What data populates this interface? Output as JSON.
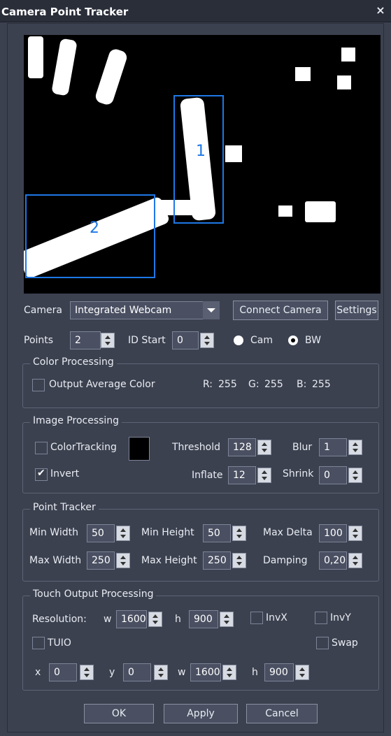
{
  "window": {
    "title": "Camera Point Tracker",
    "close_glyph": "×"
  },
  "preview": {
    "tracked_ids": [
      "1",
      "2"
    ]
  },
  "camera": {
    "label": "Camera",
    "selected": "Integrated Webcam",
    "connect_label": "Connect Camera",
    "settings_label": "Settings"
  },
  "points": {
    "label": "Points",
    "value": "2",
    "id_start_label": "ID Start",
    "id_start_value": "0",
    "mode_cam_label": "Cam",
    "mode_bw_label": "BW",
    "mode_selected": "BW"
  },
  "color_processing": {
    "title": "Color Processing",
    "avg_label": "Output Average Color",
    "avg_checked": false,
    "r_label": "R:",
    "r": "255",
    "g_label": "G:",
    "g": "255",
    "b_label": "B:",
    "b": "255"
  },
  "image_processing": {
    "title": "Image Processing",
    "colortracking_label": "ColorTracking",
    "colortracking_checked": false,
    "swatch_color": "#000000",
    "threshold_label": "Threshold",
    "threshold": "128",
    "blur_label": "Blur",
    "blur": "1",
    "invert_label": "Invert",
    "invert_checked": true,
    "inflate_label": "Inflate",
    "inflate": "12",
    "shrink_label": "Shrink",
    "shrink": "0"
  },
  "point_tracker": {
    "title": "Point Tracker",
    "min_width_label": "Min Width",
    "min_width": "50",
    "min_height_label": "Min Height",
    "min_height": "50",
    "max_delta_label": "Max Delta",
    "max_delta": "100",
    "max_width_label": "Max Width",
    "max_width": "250",
    "max_height_label": "Max Height",
    "max_height": "250",
    "damping_label": "Damping",
    "damping": "0,20"
  },
  "touch_output": {
    "title": "Touch Output Processing",
    "resolution_label": "Resolution:",
    "w_label": "w",
    "res_w": "1600",
    "h_label": "h",
    "res_h": "900",
    "invx_label": "InvX",
    "invy_label": "InvY",
    "tuio_label": "TUIO",
    "swap_label": "Swap",
    "x_label": "x",
    "x": "0",
    "y_label": "y",
    "y": "0",
    "w2_label": "w",
    "w": "1600",
    "h2_label": "h",
    "h": "900"
  },
  "buttons": {
    "ok": "OK",
    "apply": "Apply",
    "cancel": "Cancel"
  },
  "colors": {
    "accent": "#1e78e6",
    "panel": "#3c4150"
  }
}
